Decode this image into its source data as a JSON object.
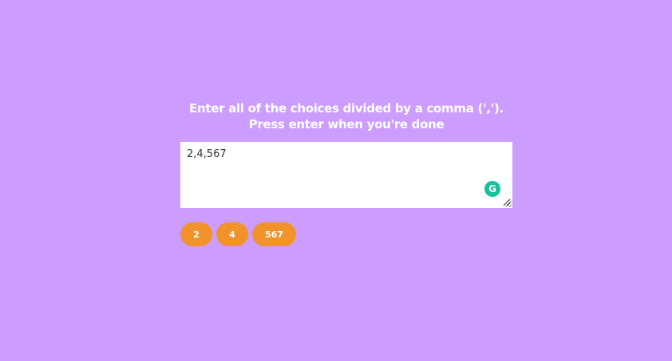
{
  "instructions": {
    "line1": "Enter all of the choices divided by a comma (',').",
    "line2": "Press enter when you're done"
  },
  "input": {
    "value": "2,4,567",
    "grammarly_letter": "G"
  },
  "choices": [
    "2",
    "4",
    "567"
  ],
  "colors": {
    "background": "#cc9dff",
    "tag": "#f2922b",
    "grammarly": "#15c39a"
  },
  "icons": {
    "grammarly": "grammarly-icon",
    "resize": "resize-handle-icon"
  }
}
